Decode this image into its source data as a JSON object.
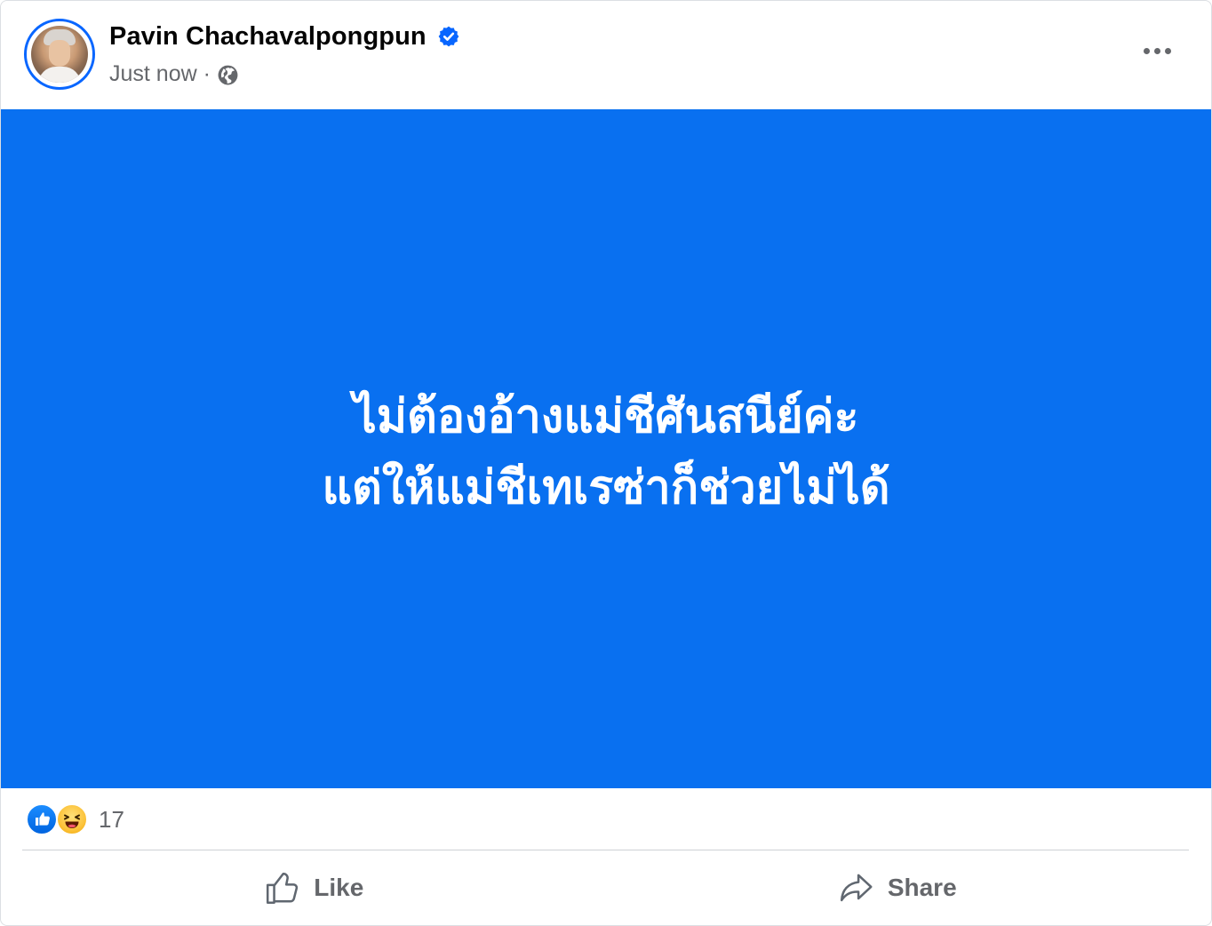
{
  "post": {
    "author": {
      "name": "Pavin Chachavalpongpun",
      "verified": true
    },
    "timestamp": "Just now",
    "separator": "·",
    "audience_icon": "globe-icon",
    "menu_icon": "more-horizontal-icon",
    "image": {
      "background_color": "#0970f0",
      "text_lines": [
        "ไม่ต้องอ้างแม่ชีศันสนีย์ค่ะ",
        "แต่ให้แม่ชีเทเรซ่าก็ช่วยไม่ได้"
      ]
    },
    "reactions": {
      "types": [
        "like",
        "haha"
      ],
      "count": "17"
    },
    "actions": {
      "like_label": "Like",
      "share_label": "Share"
    }
  },
  "colors": {
    "accent": "#0866ff",
    "secondary_text": "#65676b",
    "primary_text": "#050505"
  }
}
